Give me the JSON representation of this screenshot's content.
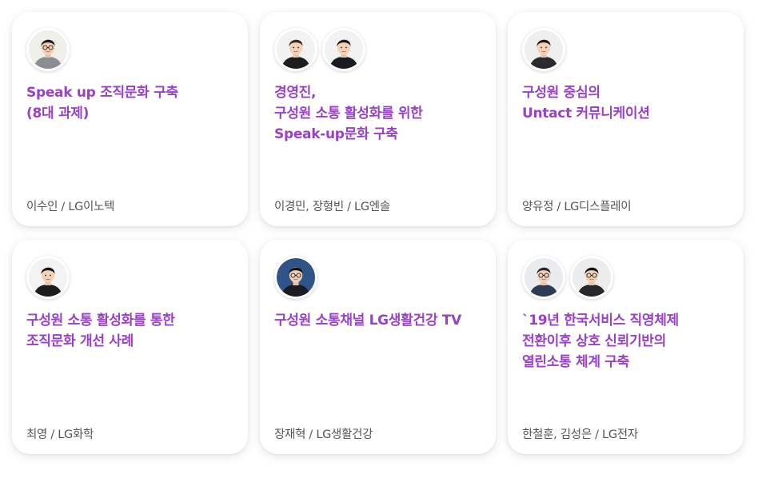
{
  "cards": [
    {
      "title": "Speak up 조직문화 구축\n(8대 과제)",
      "author": "이수인 / LG이노텍",
      "avatars": [
        {
          "icon": "person-photo-icon",
          "bg": "#f0efe9",
          "shirt": "#8a8d93",
          "hair": "#1e1e1e",
          "glasses": true
        }
      ]
    },
    {
      "title": "경영진,\n구성원 소통 활성화를 위한\nSpeak-up문화 구축",
      "author": "이경민, 장형빈 / LG엔솔",
      "avatars": [
        {
          "icon": "person-photo-icon",
          "bg": "#f2f2f2",
          "shirt": "#1d1d1d",
          "hair": "#3a2a22",
          "glasses": false
        },
        {
          "icon": "person-photo-icon",
          "bg": "#f2f2f2",
          "shirt": "#1b1b22",
          "hair": "#1a1412",
          "glasses": false
        }
      ]
    },
    {
      "title": "구성원 중심의\nUntact 커뮤니케이션",
      "author": "양유정 / LG디스플레이",
      "avatars": [
        {
          "icon": "person-photo-icon",
          "bg": "#efefef",
          "shirt": "#2a2a30",
          "hair": "#22180f",
          "glasses": false
        }
      ]
    },
    {
      "title": "구성원 소통 활성화를 통한\n조직문화 개선 사례",
      "author": "최영 / LG화학",
      "avatars": [
        {
          "icon": "person-photo-icon",
          "bg": "#f3f3f3",
          "shirt": "#1c1c1c",
          "hair": "#1a120c",
          "glasses": false
        }
      ]
    },
    {
      "title": "구성원 소통채널 LG생활건강 TV",
      "author": "장재혁 / LG생활건강",
      "avatars": [
        {
          "icon": "person-photo-icon",
          "bg": "#2f5488",
          "shirt": "#1a1a22",
          "hair": "#121212",
          "glasses": true
        }
      ]
    },
    {
      "title": "`19년 한국서비스 직영체제\n전환이후 상호 신뢰기반의\n열린소통 체계 구축",
      "author": "한철훈, 김성은 / LG전자",
      "avatars": [
        {
          "icon": "person-photo-icon",
          "bg": "#e9ecef",
          "shirt": "#2b3a55",
          "hair": "#2a2a2a",
          "glasses": true
        },
        {
          "icon": "person-photo-icon",
          "bg": "#ececec",
          "shirt": "#26262b",
          "hair": "#141414",
          "glasses": true
        }
      ]
    }
  ]
}
